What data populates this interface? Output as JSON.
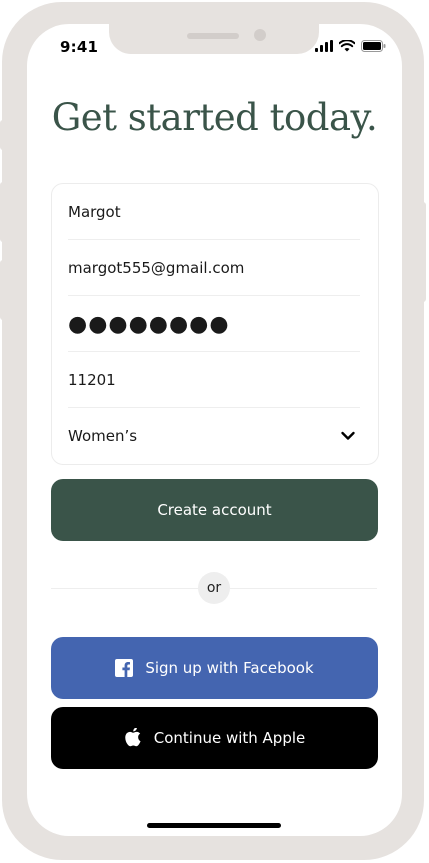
{
  "status_bar": {
    "time": "9:41"
  },
  "title": "Get started today.",
  "form": {
    "name_value": "Margot",
    "email_value": "margot555@gmail.com",
    "password_dots": "●●●●●●●●",
    "zip_value": "11201",
    "category_value": "Women’s"
  },
  "create_label": "Create account",
  "or_label": "or",
  "facebook_label": "Sign up with Facebook",
  "apple_label": "Continue with Apple",
  "colors": {
    "accent": "#3a5449",
    "facebook": "#4465b0",
    "apple": "#000000",
    "frame": "#e6e2df"
  },
  "icons": [
    "signal-icon",
    "wifi-icon",
    "battery-icon",
    "chevron-down-icon",
    "facebook-icon",
    "apple-icon"
  ]
}
